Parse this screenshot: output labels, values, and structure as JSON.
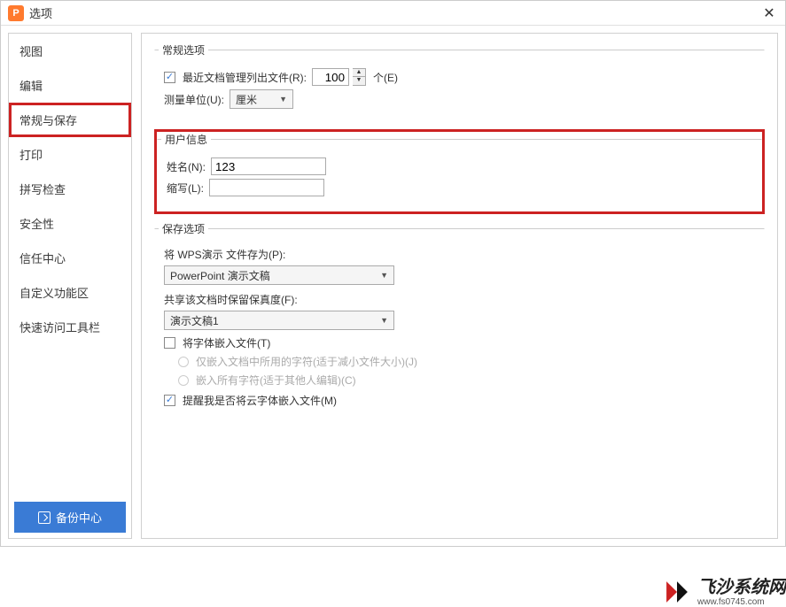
{
  "window": {
    "title": "选项"
  },
  "sidebar": {
    "items": [
      "视图",
      "编辑",
      "常规与保存",
      "打印",
      "拼写检查",
      "安全性",
      "信任中心",
      "自定义功能区",
      "快速访问工具栏"
    ],
    "selected_index": 2,
    "backup_button": "备份中心"
  },
  "general_options": {
    "legend": "常规选项",
    "recent_files_label": "最近文档管理列出文件(R):",
    "recent_files_value": "100",
    "recent_files_suffix": "个(E)",
    "unit_label": "测量单位(U):",
    "unit_value": "厘米"
  },
  "user_info": {
    "legend": "用户信息",
    "name_label": "姓名(N):",
    "name_value": "123",
    "initials_label": "缩写(L):",
    "initials_value": ""
  },
  "save_options": {
    "legend": "保存选项",
    "save_as_label": "将 WPS演示 文件存为(P):",
    "save_as_value": "PowerPoint 演示文稿",
    "fidelity_label": "共享该文档时保留保真度(F):",
    "fidelity_value": "演示文稿1",
    "embed_fonts_label": "将字体嵌入文件(T)",
    "embed_subset_label": "仅嵌入文档中所用的字符(适于减小文件大小)(J)",
    "embed_all_label": "嵌入所有字符(适于其他人编辑)(C)",
    "remind_cloud_fonts_label": "提醒我是否将云字体嵌入文件(M)"
  },
  "watermark": {
    "text": "飞沙系统网",
    "url": "www.fs0745.com"
  }
}
